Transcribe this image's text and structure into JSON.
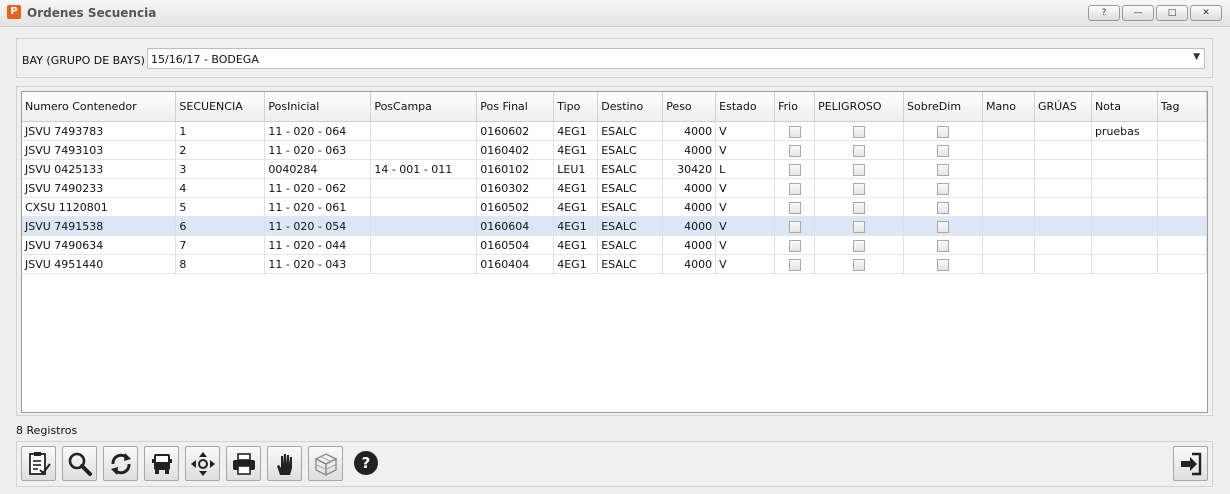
{
  "window": {
    "title": "Ordenes Secuencia",
    "app_icon_glyph": "P",
    "buttons": {
      "help": "?",
      "minimize": "—",
      "maximize": "□",
      "close": "✕"
    }
  },
  "bay": {
    "label": "BAY (GRUPO DE BAYS)",
    "selected": "15/16/17 - BODEGA",
    "arrow": "▼"
  },
  "grid": {
    "columns": [
      "Numero Contenedor",
      "SECUENCIA",
      "PosInicial",
      "PosCampa",
      "Pos Final",
      "Tipo",
      "Destino",
      "Peso",
      "Estado",
      "Frio",
      "PELIGROSO",
      "SobreDim",
      "Mano",
      "GRÚAS",
      "Nota",
      "Tag"
    ],
    "rows": [
      {
        "contenedor": "JSVU 7493783",
        "secuencia": "1",
        "pos_inicial": "11 - 020 - 064",
        "pos_campa": "",
        "pos_final": "0160602",
        "tipo": "4EG1",
        "destino": "ESALC",
        "peso": "4000",
        "estado": "V",
        "frio": false,
        "peligroso": false,
        "sobredim": false,
        "mano": "",
        "gruas": "",
        "nota": "pruebas",
        "tag": ""
      },
      {
        "contenedor": "JSVU 7493103",
        "secuencia": "2",
        "pos_inicial": "11 - 020 - 063",
        "pos_campa": "",
        "pos_final": "0160402",
        "tipo": "4EG1",
        "destino": "ESALC",
        "peso": "4000",
        "estado": "V",
        "frio": false,
        "peligroso": false,
        "sobredim": false,
        "mano": "",
        "gruas": "",
        "nota": "",
        "tag": ""
      },
      {
        "contenedor": "JSVU 0425133",
        "secuencia": "3",
        "pos_inicial": "0040284",
        "pos_campa": "14 - 001 - 011",
        "pos_final": "0160102",
        "tipo": "LEU1",
        "destino": "ESALC",
        "peso": "30420",
        "estado": "L",
        "frio": false,
        "peligroso": false,
        "sobredim": false,
        "mano": "",
        "gruas": "",
        "nota": "",
        "tag": ""
      },
      {
        "contenedor": "JSVU 7490233",
        "secuencia": "4",
        "pos_inicial": "11 - 020 - 062",
        "pos_campa": "",
        "pos_final": "0160302",
        "tipo": "4EG1",
        "destino": "ESALC",
        "peso": "4000",
        "estado": "V",
        "frio": false,
        "peligroso": false,
        "sobredim": false,
        "mano": "",
        "gruas": "",
        "nota": "",
        "tag": ""
      },
      {
        "contenedor": "CXSU 1120801",
        "secuencia": "5",
        "pos_inicial": "11 - 020 - 061",
        "pos_campa": "",
        "pos_final": "0160502",
        "tipo": "4EG1",
        "destino": "ESALC",
        "peso": "4000",
        "estado": "V",
        "frio": false,
        "peligroso": false,
        "sobredim": false,
        "mano": "",
        "gruas": "",
        "nota": "",
        "tag": ""
      },
      {
        "contenedor": "JSVU 7491538",
        "secuencia": "6",
        "pos_inicial": "11 - 020 - 054",
        "pos_campa": "",
        "pos_final": "0160604",
        "tipo": "4EG1",
        "destino": "ESALC",
        "peso": "4000",
        "estado": "V",
        "frio": false,
        "peligroso": false,
        "sobredim": false,
        "mano": "",
        "gruas": "",
        "nota": "",
        "tag": "",
        "selected": true
      },
      {
        "contenedor": "JSVU 7490634",
        "secuencia": "7",
        "pos_inicial": "11 - 020 - 044",
        "pos_campa": "",
        "pos_final": "0160504",
        "tipo": "4EG1",
        "destino": "ESALC",
        "peso": "4000",
        "estado": "V",
        "frio": false,
        "peligroso": false,
        "sobredim": false,
        "mano": "",
        "gruas": "",
        "nota": "",
        "tag": ""
      },
      {
        "contenedor": "JSVU 4951440",
        "secuencia": "8",
        "pos_inicial": "11 - 020 - 043",
        "pos_campa": "",
        "pos_final": "0160404",
        "tipo": "4EG1",
        "destino": "ESALC",
        "peso": "4000",
        "estado": "V",
        "frio": false,
        "peligroso": false,
        "sobredim": false,
        "mano": "",
        "gruas": "",
        "nota": "",
        "tag": ""
      }
    ]
  },
  "status": {
    "records": "8 Registros"
  },
  "toolbar": {
    "buttons": [
      "edit-list-icon",
      "search-icon",
      "refresh-icon",
      "truck-icon",
      "move-icon",
      "print-icon",
      "hand-icon",
      "cube-icon",
      "help-icon"
    ],
    "exit": "exit-icon"
  },
  "colors": {
    "selection": "#dbe7f7",
    "app_icon": "#e8641a"
  }
}
